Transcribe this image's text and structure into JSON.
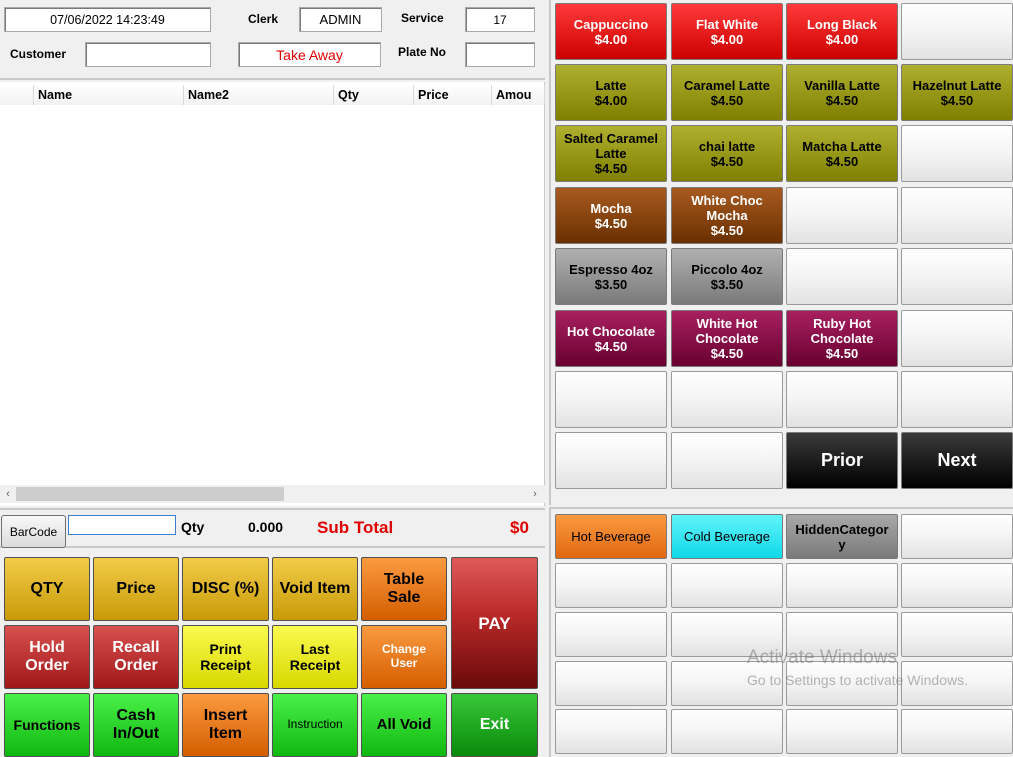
{
  "header": {
    "datetime": "07/06/2022 14:23:49",
    "clerk_label": "Clerk",
    "clerk_value": "ADMIN",
    "service_label": "Service",
    "service_value": "17",
    "customer_label": "Customer",
    "customer_value": "",
    "order_type": "Take Away",
    "plate_label": "Plate No",
    "plate_value": ""
  },
  "order_grid": {
    "columns": [
      "Name",
      "Name2",
      "Qty",
      "Price",
      "Amou"
    ]
  },
  "barcode_bar": {
    "barcode_button": "BarCode",
    "barcode_value": "",
    "qty_label": "Qty",
    "qty_value": "0.000",
    "subtotal_label": "Sub Total",
    "subtotal_value": "$0"
  },
  "function_keys": {
    "qty": "QTY",
    "price": "Price",
    "disc": "DISC (%)",
    "void_item": "Void Item",
    "table_sale": "Table Sale",
    "pay": "PAY",
    "hold_order": "Hold Order",
    "recall_order": "Recall Order",
    "print_receipt": "Print Receipt",
    "last_receipt": "Last Receipt",
    "change_user": "Change User",
    "functions": "Functions",
    "cash_in_out": "Cash In/Out",
    "insert_item": "Insert Item",
    "instruction": "Instruction",
    "all_void": "All Void",
    "exit": "Exit"
  },
  "products": {
    "cappuccino": {
      "name": "Cappuccino",
      "price": "$4.00"
    },
    "flat_white": {
      "name": "Flat White",
      "price": "$4.00"
    },
    "long_black": {
      "name": "Long Black",
      "price": "$4.00"
    },
    "latte": {
      "name": "Latte",
      "price": "$4.00"
    },
    "caramel_latte": {
      "name": "Caramel Latte",
      "price": "$4.50"
    },
    "vanilla_latte": {
      "name": "Vanilla Latte",
      "price": "$4.50"
    },
    "hazelnut_latte": {
      "name": "Hazelnut Latte",
      "price": "$4.50"
    },
    "salted_caramel_latte": {
      "name": "Salted Caramel Latte",
      "price": "$4.50"
    },
    "chai_latte": {
      "name": "chai latte",
      "price": "$4.50"
    },
    "matcha_latte": {
      "name": "Matcha Latte",
      "price": "$4.50"
    },
    "mocha": {
      "name": "Mocha",
      "price": "$4.50"
    },
    "white_choc_mocha": {
      "name": "White Choc Mocha",
      "price": "$4.50"
    },
    "espresso": {
      "name": "Espresso 4oz",
      "price": "$3.50"
    },
    "piccolo": {
      "name": "Piccolo 4oz",
      "price": "$3.50"
    },
    "hot_chocolate": {
      "name": "Hot Chocolate",
      "price": "$4.50"
    },
    "white_hot_chocolate": {
      "name": "White Hot Chocolate",
      "price": "$4.50"
    },
    "ruby_hot_chocolate": {
      "name": "Ruby Hot Chocolate",
      "price": "$4.50"
    },
    "prior": "Prior",
    "next": "Next"
  },
  "categories": {
    "hot_beverage": "Hot Beverage",
    "cold_beverage": "Cold Beverage",
    "hidden": "HiddenCategory"
  },
  "watermark": {
    "title": "Activate Windows",
    "subtitle": "Go to Settings to activate Windows."
  },
  "colors": {
    "red": "#e01010",
    "olive": "#a0a020",
    "brown": "#8b4513",
    "gray": "#909090",
    "maroon": "#8b1040",
    "orange": "#f07a18",
    "cyan": "#20e8f0",
    "subtotal_red": "#e00000"
  }
}
